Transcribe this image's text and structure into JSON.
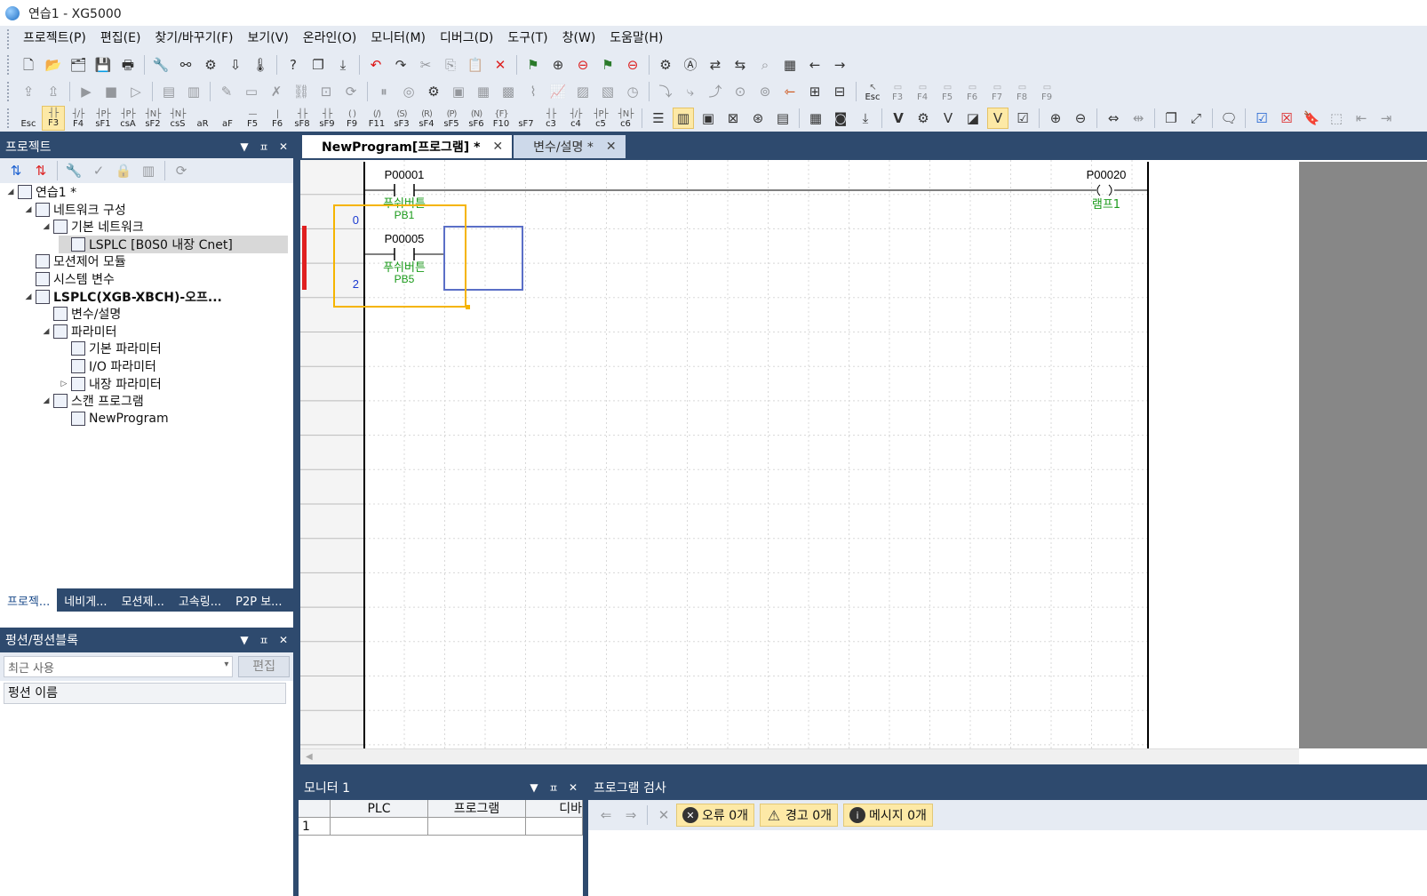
{
  "window": {
    "title": "연습1 - XG5000"
  },
  "menu": [
    "프로젝트(P)",
    "편집(E)",
    "찾기/바꾸기(F)",
    "보기(V)",
    "온라인(O)",
    "모니터(M)",
    "디버그(D)",
    "도구(T)",
    "창(W)",
    "도움말(H)"
  ],
  "toolbar3": {
    "fkeys": [
      {
        "sym": "",
        "label": "Esc"
      },
      {
        "sym": "┤├",
        "label": "F3"
      },
      {
        "sym": "┤/├",
        "label": "F4"
      },
      {
        "sym": "┤P├",
        "label": "sF1"
      },
      {
        "sym": "┤P├",
        "label": "csA"
      },
      {
        "sym": "┤N├",
        "label": "sF2"
      },
      {
        "sym": "┤N├",
        "label": "csS"
      },
      {
        "sym": "",
        "label": "aR"
      },
      {
        "sym": "",
        "label": "aF"
      },
      {
        "sym": "—",
        "label": "F5"
      },
      {
        "sym": "|",
        "label": "F6"
      },
      {
        "sym": "┤├",
        "label": "sF8"
      },
      {
        "sym": "┤├",
        "label": "sF9"
      },
      {
        "sym": "( )",
        "label": "F9"
      },
      {
        "sym": "(/)",
        "label": "F11"
      },
      {
        "sym": "(S)",
        "label": "sF3"
      },
      {
        "sym": "(R)",
        "label": "sF4"
      },
      {
        "sym": "(P)",
        "label": "sF5"
      },
      {
        "sym": "(N)",
        "label": "sF6"
      },
      {
        "sym": "{F}",
        "label": "F10"
      },
      {
        "sym": "",
        "label": "sF7"
      },
      {
        "sym": "┤├",
        "label": "c3"
      },
      {
        "sym": "┤/├",
        "label": "c4"
      },
      {
        "sym": "┤P├",
        "label": "c5"
      },
      {
        "sym": "┤N├",
        "label": "c6"
      }
    ],
    "esc_fkeys": [
      "F3",
      "F4",
      "F5",
      "F6",
      "F7",
      "F8",
      "F9"
    ]
  },
  "project_panel": {
    "title": "프로젝트",
    "pin": "ㅍ",
    "close": "✕",
    "tree": [
      {
        "label": "연습1 *",
        "level": 0,
        "expander": "◢",
        "icon": "project-icon"
      },
      {
        "label": "네트워크 구성",
        "level": 1,
        "expander": "◢",
        "icon": "network-icon"
      },
      {
        "label": "기본 네트워크",
        "level": 2,
        "expander": "◢",
        "icon": "network-grid-icon"
      },
      {
        "label": "LSPLC [B0S0 내장 Cnet]",
        "level": 3,
        "expander": "",
        "icon": "plc-device-icon",
        "selected": true
      },
      {
        "label": "모션제어 모듈",
        "level": 1,
        "expander": "",
        "icon": "motion-module-icon"
      },
      {
        "label": "시스템 변수",
        "level": 1,
        "expander": "",
        "icon": "system-variable-icon"
      },
      {
        "label": "LSPLC(XGB-XBCH)-오프...",
        "level": 1,
        "expander": "◢",
        "icon": "plc-cpu-icon",
        "bold": true
      },
      {
        "label": "변수/설명",
        "level": 2,
        "expander": "",
        "icon": "variable-icon"
      },
      {
        "label": "파라미터",
        "level": 2,
        "expander": "◢",
        "icon": "parameter-icon"
      },
      {
        "label": "기본 파라미터",
        "level": 3,
        "expander": "",
        "icon": "document-icon"
      },
      {
        "label": "I/O 파라미터",
        "level": 3,
        "expander": "",
        "icon": "io-parameter-icon"
      },
      {
        "label": "내장 파라미터",
        "level": 3,
        "expander": "▷",
        "icon": "builtin-parameter-icon"
      },
      {
        "label": "스캔 프로그램",
        "level": 2,
        "expander": "◢",
        "icon": "scan-program-icon"
      },
      {
        "label": "NewProgram",
        "level": 3,
        "expander": "",
        "icon": "ladder-program-icon"
      }
    ],
    "tabs": [
      "프로젝...",
      "네비게...",
      "모션제...",
      "고속링...",
      "P2P 보..."
    ]
  },
  "function_panel": {
    "title": "펑션/펑션블록",
    "select_value": "최근 사용",
    "edit_label": "편집",
    "column_header": "펑션 이름"
  },
  "editor": {
    "tabs": [
      {
        "label": "NewProgram[프로그램] *",
        "active": true
      },
      {
        "label": "변수/설명 *",
        "active": false
      }
    ],
    "close_glyph": "✕",
    "rungs": [
      {
        "step": "0",
        "contact": "P00001",
        "contact_comment": "푸쉬버튼",
        "contact_label": "PB1",
        "coil": "P00020",
        "coil_label": "램프1"
      },
      {
        "step": "2",
        "contact": "P00005",
        "contact_comment": "푸쉬버튼",
        "contact_label": "PB5"
      }
    ]
  },
  "monitor_panel": {
    "title": "모니터 1",
    "columns": [
      "PLC",
      "프로그램",
      "디바"
    ],
    "rows": [
      [
        "1",
        "",
        "",
        ""
      ]
    ]
  },
  "check_panel": {
    "title": "프로그램 검사",
    "chips": [
      {
        "icon": "error-icon",
        "label": "오류 0개"
      },
      {
        "icon": "warning-icon",
        "label": "경고 0개"
      },
      {
        "icon": "info-icon",
        "label": "메시지 0개"
      }
    ]
  },
  "colors": {
    "frame": "#2e4a6e",
    "toolbar": "#e6ebf3",
    "comment_green": "#1a9a1a",
    "step_blue": "#1a3ad0",
    "selection_orange": "#f5b400",
    "cursor_blue": "#5b6fc7",
    "breakpoint_red": "#e02020"
  }
}
